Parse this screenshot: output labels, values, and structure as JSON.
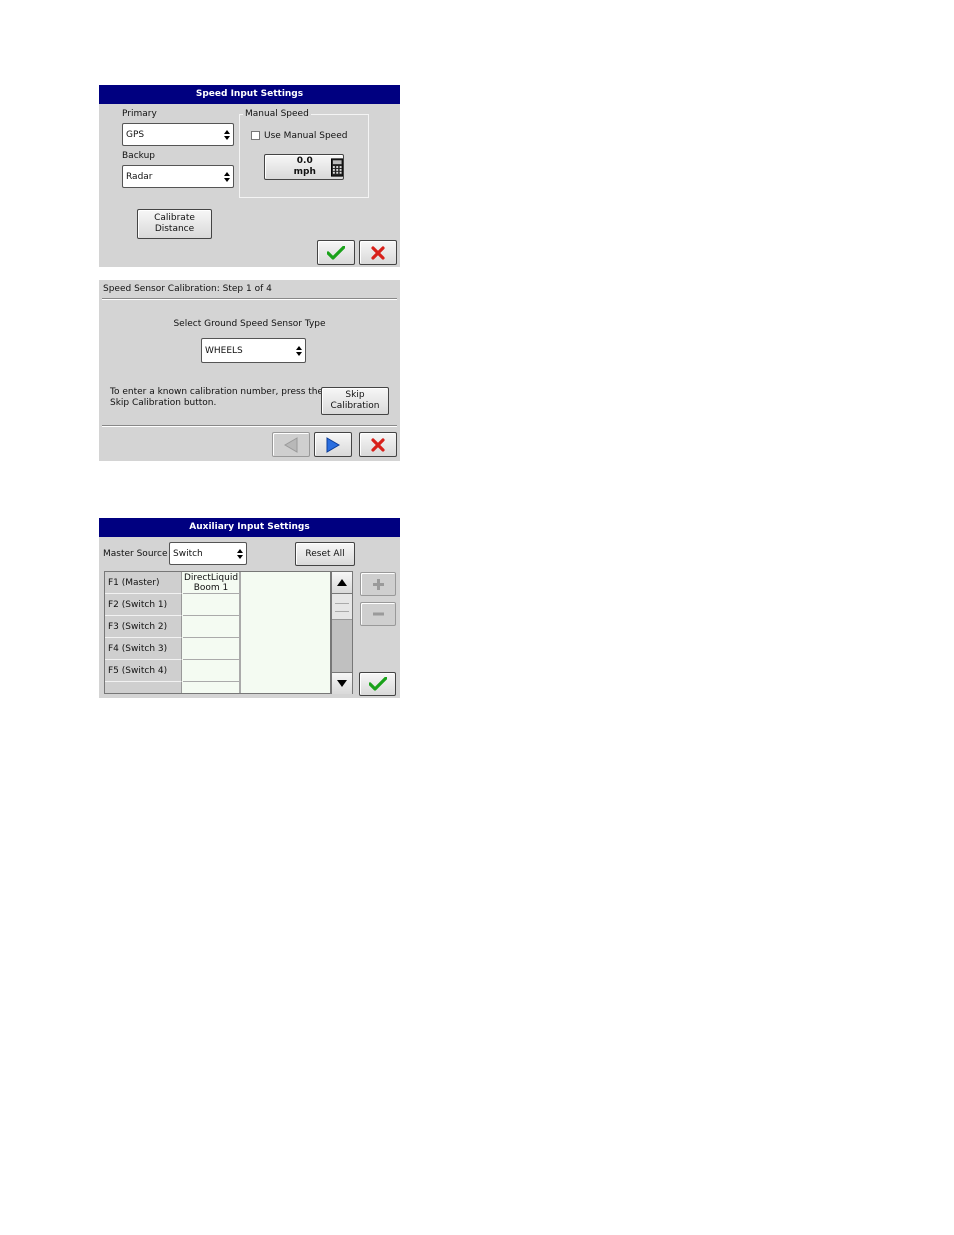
{
  "colors": {
    "titlebar": "#000080",
    "panel": "#d4d4d4",
    "ok_green": "#1aa21a",
    "cancel_red": "#d8201a",
    "nav_blue": "#2a6ee0",
    "list_bg": "#f4fbf2"
  },
  "speed_input": {
    "title": "Speed Input Settings",
    "primary_label": "Primary",
    "primary_value": "GPS",
    "backup_label": "Backup",
    "backup_value": "Radar",
    "manual_group_label": "Manual Speed",
    "use_manual_label": "Use Manual Speed",
    "manual_speed_value": "0.0 mph",
    "calibrate_line1": "Calibrate",
    "calibrate_line2": "Distance",
    "icons": {
      "ok": "checkmark-icon",
      "cancel": "x-icon",
      "calculator": "calculator-icon"
    }
  },
  "speed_cal": {
    "title": "Speed Sensor Calibration:  Step 1 of 4",
    "prompt": "Select Ground Speed Sensor Type",
    "sensor_value": "WHEELS",
    "help_line1": "To enter a known calibration number, press the",
    "help_line2": "Skip Calibration button.",
    "skip_line1": "Skip",
    "skip_line2": "Calibration",
    "icons": {
      "back": "left-arrow-icon",
      "next": "right-arrow-icon",
      "cancel": "x-icon"
    }
  },
  "aux_input": {
    "title": "Auxiliary Input Settings",
    "master_source_label": "Master Source",
    "master_source_value": "Switch",
    "reset_all_label": "Reset All",
    "rows": [
      {
        "label": "F1 (Master)",
        "value_line1": "DirectLiquid",
        "value_line2": "Boom 1"
      },
      {
        "label": "F2 (Switch 1)",
        "value_line1": "",
        "value_line2": ""
      },
      {
        "label": "F3 (Switch 2)",
        "value_line1": "",
        "value_line2": ""
      },
      {
        "label": "F4 (Switch 3)",
        "value_line1": "",
        "value_line2": ""
      },
      {
        "label": "F5 (Switch 4)",
        "value_line1": "",
        "value_line2": ""
      }
    ],
    "icons": {
      "add": "plus-icon",
      "remove": "minus-icon",
      "ok": "checkmark-icon",
      "scroll_up": "scroll-up-icon",
      "scroll_down": "scroll-down-icon"
    }
  }
}
